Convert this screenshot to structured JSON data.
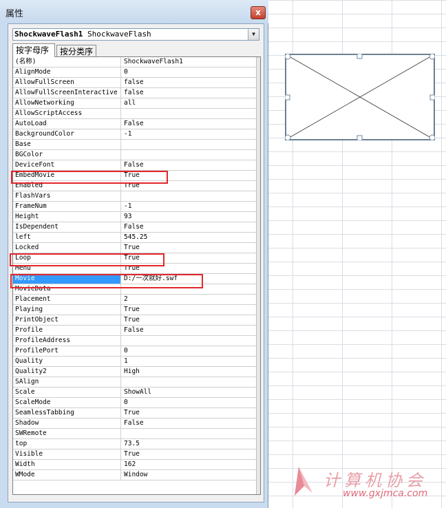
{
  "window": {
    "title": "属性",
    "close_glyph": "x"
  },
  "object_selector": {
    "name": "ShockwaveFlash1",
    "type": "ShockwaveFlash"
  },
  "tabs": [
    {
      "label": "按字母序"
    },
    {
      "label": "按分类序"
    }
  ],
  "properties": [
    {
      "name": "(名称)",
      "value": "ShockwaveFlash1"
    },
    {
      "name": "AlignMode",
      "value": "0"
    },
    {
      "name": "AllowFullScreen",
      "value": "false"
    },
    {
      "name": "AllowFullScreenInteractive",
      "value": "false"
    },
    {
      "name": "AllowNetworking",
      "value": "all"
    },
    {
      "name": "AllowScriptAccess",
      "value": ""
    },
    {
      "name": "AutoLoad",
      "value": "False"
    },
    {
      "name": "BackgroundColor",
      "value": "-1"
    },
    {
      "name": "Base",
      "value": ""
    },
    {
      "name": "BGColor",
      "value": ""
    },
    {
      "name": "DeviceFont",
      "value": "False"
    },
    {
      "name": "EmbedMovie",
      "value": "True"
    },
    {
      "name": "Enabled",
      "value": "True"
    },
    {
      "name": "FlashVars",
      "value": ""
    },
    {
      "name": "FrameNum",
      "value": "-1"
    },
    {
      "name": "Height",
      "value": "93"
    },
    {
      "name": "IsDependent",
      "value": "False"
    },
    {
      "name": "left",
      "value": "545.25"
    },
    {
      "name": "Locked",
      "value": "True"
    },
    {
      "name": "Loop",
      "value": "True"
    },
    {
      "name": "Menu",
      "value": "True"
    },
    {
      "name": "Movie",
      "value": "D:/一次就好.swf"
    },
    {
      "name": "MovieData",
      "value": ""
    },
    {
      "name": "Placement",
      "value": "2"
    },
    {
      "name": "Playing",
      "value": "True"
    },
    {
      "name": "PrintObject",
      "value": "True"
    },
    {
      "name": "Profile",
      "value": "False"
    },
    {
      "name": "ProfileAddress",
      "value": ""
    },
    {
      "name": "ProfilePort",
      "value": "0"
    },
    {
      "name": "Quality",
      "value": "1"
    },
    {
      "name": "Quality2",
      "value": "High"
    },
    {
      "name": "SAlign",
      "value": ""
    },
    {
      "name": "Scale",
      "value": "ShowAll"
    },
    {
      "name": "ScaleMode",
      "value": "0"
    },
    {
      "name": "SeamlessTabbing",
      "value": "True"
    },
    {
      "name": "Shadow",
      "value": "False"
    },
    {
      "name": "SWRemote",
      "value": ""
    },
    {
      "name": "top",
      "value": "73.5"
    },
    {
      "name": "Visible",
      "value": "True"
    },
    {
      "name": "Width",
      "value": "162"
    },
    {
      "name": "WMode",
      "value": "Window"
    }
  ],
  "selected_property": "Movie",
  "highlight_color": "#e2262b",
  "watermark": {
    "logo_text": "",
    "text": "计算机协会",
    "url": "www.gxjmca.com"
  }
}
